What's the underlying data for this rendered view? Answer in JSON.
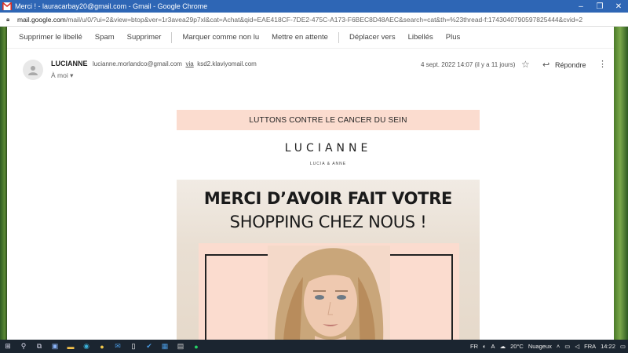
{
  "window": {
    "title": "Merci ! - lauracarbay20@gmail.com - Gmail - Google Chrome",
    "controls": [
      "–",
      "❐",
      "✕"
    ]
  },
  "address": {
    "url_host": "mail.google.com",
    "url_rest": "/mail/u/0/?ui=2&view=btop&ver=1r3avea29p7xl&cat=Achat&qid=EAE418CF-7DE2-475C-A173-F6BEC8D48AEC&search=cat&th=%23thread-f:1743040790597825444&cvid=2"
  },
  "toolbar": {
    "items": [
      "Supprimer le libellé",
      "Spam",
      "Supprimer",
      "Marquer comme non lu",
      "Mettre en attente",
      "Déplacer vers",
      "Libellés",
      "Plus"
    ]
  },
  "message": {
    "sender_name": "LUCIANNE",
    "sender_email": "lucianne.morlandco@gmail.com",
    "via_label": "via",
    "via_address": "ksd2.klaviyomail.com",
    "to": "À moi",
    "date": "4 sept. 2022 14:07 (il y a 11 jours)",
    "reply_label": "Répondre"
  },
  "email_body": {
    "banner": "LUTTONS CONTRE LE CANCER DU SEIN",
    "logo": "LUCIANNE",
    "logo_sub": "LUCIA & ANNE",
    "hero_line1": "MERCI D’AVOIR FAIT VOTRE",
    "hero_line2": "SHOPPING CHEZ NOUS !"
  },
  "taskbar": {
    "weather": "20°C",
    "weather_desc": "Nuageux",
    "lang": "FRA",
    "time": "14:22",
    "input_lang": "FR"
  },
  "colors": {
    "titlebar": "#2e66b5",
    "banner": "#fbdccf",
    "taskbar": "#1b2530"
  }
}
